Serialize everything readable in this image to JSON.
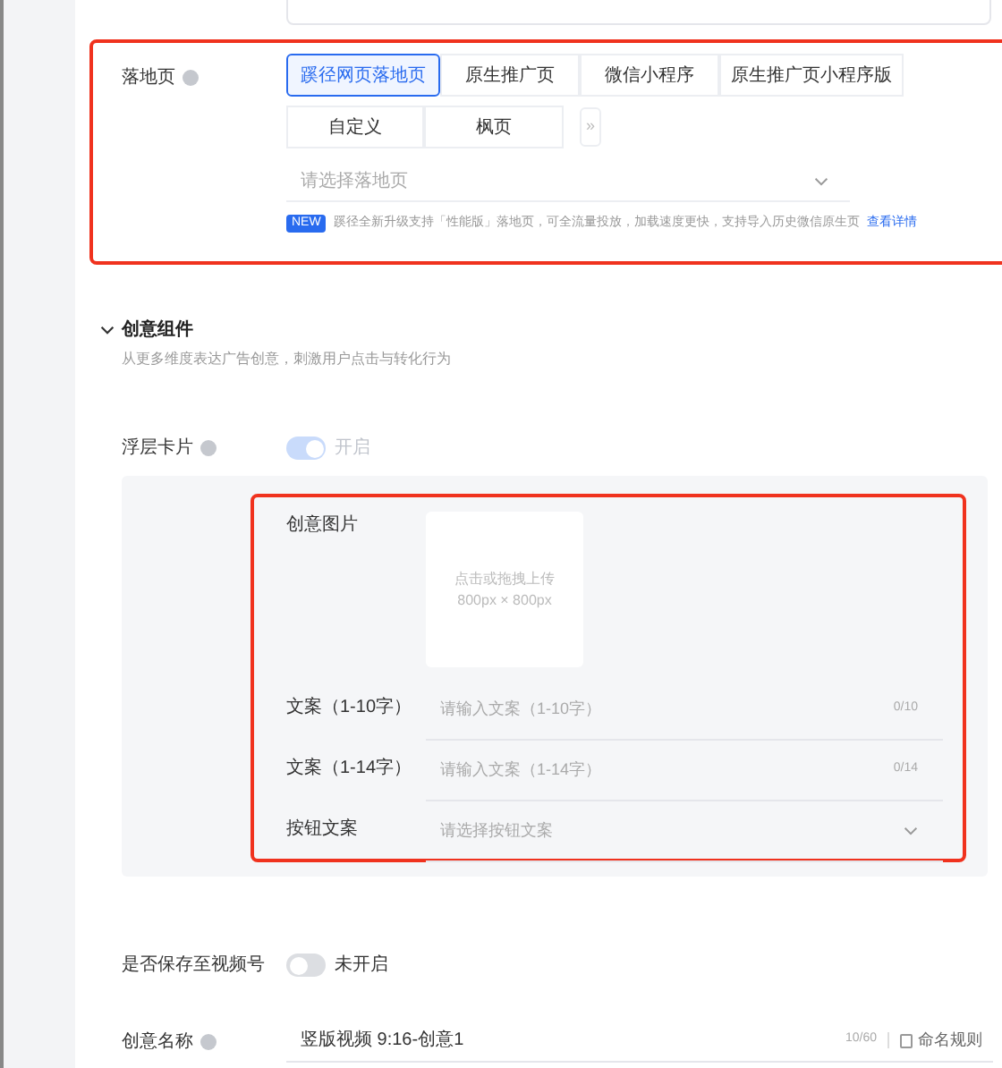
{
  "landing_page": {
    "label": "落地页",
    "tabs": [
      {
        "label": "蹊径网页落地页",
        "selected": true
      },
      {
        "label": "原生推广页",
        "selected": false
      },
      {
        "label": "微信小程序",
        "selected": false
      },
      {
        "label": "原生推广页小程序版",
        "selected": false
      },
      {
        "label": "自定义",
        "selected": false
      },
      {
        "label": "枫页",
        "selected": false
      }
    ],
    "more": "»",
    "select_placeholder": "请选择落地页",
    "badge": "NEW",
    "notice": "蹊径全新升级支持「性能版」落地页，可全流量投放，加载速度更快，支持导入历史微信原生页",
    "link": "查看详情"
  },
  "creative_components": {
    "title": "创意组件",
    "expanded": true,
    "description": "从更多维度表达广告创意，刺激用户点击与转化行为",
    "floating_card": {
      "label": "浮层卡片",
      "on": true,
      "disabled": true,
      "state_text": "开启",
      "fields": [
        {
          "kind": "image",
          "label": "创意图片",
          "hint": "点击或拖拽上传",
          "size": "800px × 800px"
        },
        {
          "kind": "text",
          "label": "文案（1-10字）",
          "placeholder": "请输入文案（1-10字）",
          "count": "0/10"
        },
        {
          "kind": "text",
          "label": "文案（1-14字）",
          "placeholder": "请输入文案（1-14字）",
          "count": "0/14"
        },
        {
          "kind": "select",
          "label": "按钮文案",
          "placeholder": "请选择按钮文案"
        }
      ]
    }
  },
  "save_to_channels": {
    "label": "是否保存至视频号",
    "on": false,
    "state_text": "未开启"
  },
  "creative_name": {
    "label": "创意名称",
    "value": "竖版视频 9:16-创意1",
    "count": "10/60",
    "rule_link": "命名规则"
  }
}
